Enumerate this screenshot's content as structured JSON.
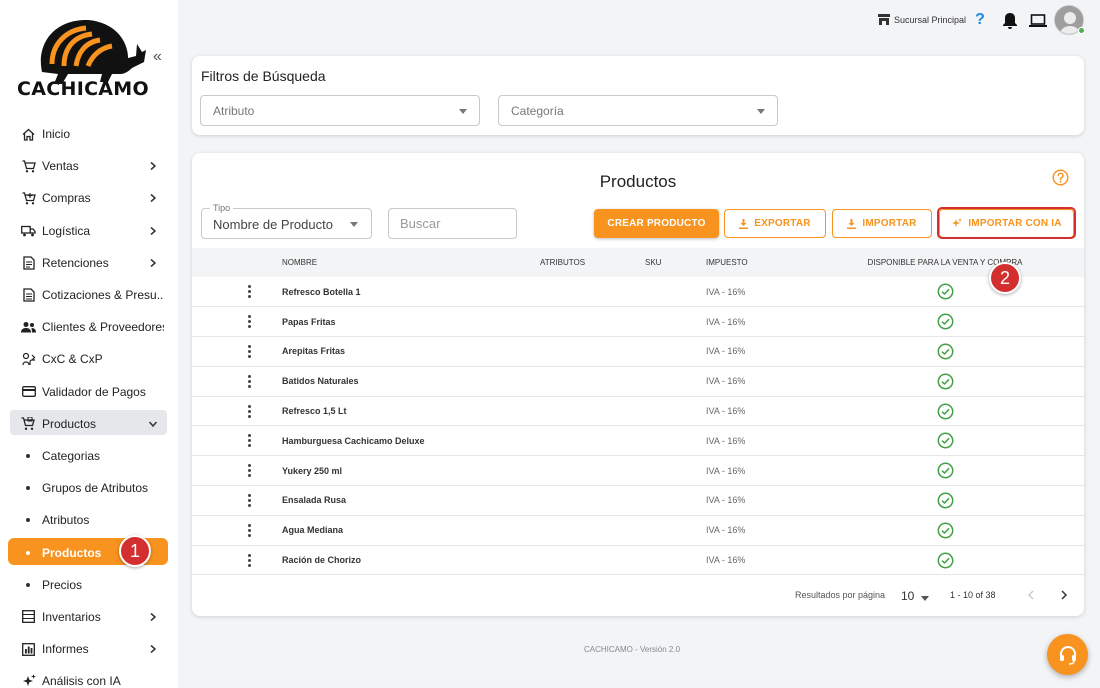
{
  "brand": {
    "name": "CACHICAMO",
    "accent": "#f7931e",
    "highlight": "#d32f2f"
  },
  "topbar": {
    "branch": "Sucursal Principal",
    "icons": [
      "store-icon",
      "help-icon",
      "bell-icon",
      "laptop-icon",
      "avatar"
    ]
  },
  "sidebar": {
    "items": [
      {
        "label": "Inicio",
        "icon": "home-icon",
        "chevron": false
      },
      {
        "label": "Ventas",
        "icon": "cart-icon",
        "chevron": true
      },
      {
        "label": "Compras",
        "icon": "cart-plus-icon",
        "chevron": true
      },
      {
        "label": "Logística",
        "icon": "truck-icon",
        "chevron": true
      },
      {
        "label": "Retenciones",
        "icon": "document-icon",
        "chevron": true
      },
      {
        "label": "Cotizaciones & Presu...",
        "icon": "quote-icon",
        "chevron": false
      },
      {
        "label": "Clientes & Proveedores",
        "icon": "people-icon",
        "chevron": false
      },
      {
        "label": "CxC & CxP",
        "icon": "exchange-icon",
        "chevron": false
      },
      {
        "label": "Validador de Pagos",
        "icon": "card-icon",
        "chevron": false
      },
      {
        "label": "Productos",
        "icon": "products-icon",
        "chevron": true,
        "expanded": true
      },
      {
        "label": "Categorias",
        "sub": true
      },
      {
        "label": "Grupos de Atributos",
        "sub": true
      },
      {
        "label": "Atributos",
        "sub": true
      },
      {
        "label": "Productos",
        "sub": true,
        "active": true,
        "badge": "1"
      },
      {
        "label": "Precios",
        "sub": true
      },
      {
        "label": "Inventarios",
        "icon": "inventory-icon",
        "chevron": true
      },
      {
        "label": "Informes",
        "icon": "report-icon",
        "chevron": true
      },
      {
        "label": "Análisis con IA",
        "icon": "sparkle-icon",
        "chevron": false
      }
    ]
  },
  "filters": {
    "title": "Filtros de Búsqueda",
    "atributo_placeholder": "Atributo",
    "categoria_placeholder": "Categoría"
  },
  "products": {
    "title": "Productos",
    "tipo_label": "Tipo",
    "tipo_value": "Nombre de Producto",
    "search_placeholder": "Buscar",
    "buttons": {
      "create": "CREAR PRODUCTO",
      "export": "EXPORTAR",
      "import": "IMPORTAR",
      "import_ai": "IMPORTAR CON IA"
    },
    "step_badge": "2",
    "columns": [
      "NOMBRE",
      "ATRIBUTOS",
      "SKU",
      "IMPUESTO",
      "DISPONIBLE PARA LA VENTA Y COMPRA"
    ],
    "rows": [
      {
        "name": "Refresco Botella 1",
        "tax": "IVA - 16%"
      },
      {
        "name": "Papas Fritas",
        "tax": "IVA - 16%"
      },
      {
        "name": "Arepitas Fritas",
        "tax": "IVA - 16%"
      },
      {
        "name": "Batidos Naturales",
        "tax": "IVA - 16%"
      },
      {
        "name": "Refresco 1,5 Lt",
        "tax": "IVA - 16%"
      },
      {
        "name": "Hamburguesa Cachicamo Deluxe",
        "tax": "IVA - 16%"
      },
      {
        "name": "Yukery 250 ml",
        "tax": "IVA - 16%"
      },
      {
        "name": "Ensalada Rusa",
        "tax": "IVA - 16%"
      },
      {
        "name": "Agua Mediana",
        "tax": "IVA - 16%"
      },
      {
        "name": "Ración de Chorizo",
        "tax": "IVA - 16%"
      }
    ],
    "pagination": {
      "label": "Resultados por página",
      "page_size": "10",
      "range": "1 - 10 of 38"
    }
  },
  "footer": {
    "text": "CACHICAMO - Versión 2.0"
  }
}
